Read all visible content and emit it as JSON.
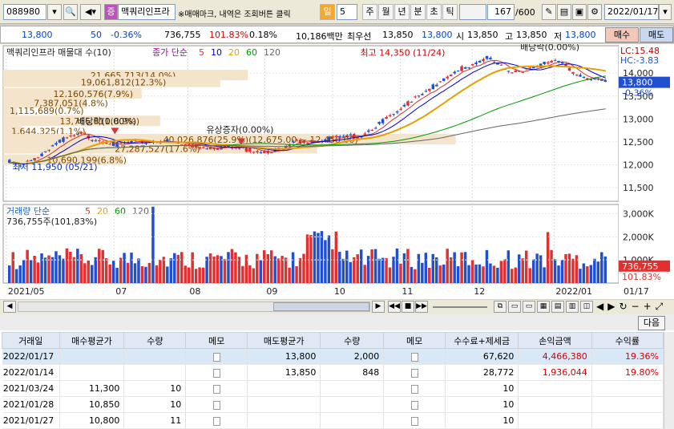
{
  "toolbar": {
    "code": "088980",
    "mark": "증",
    "stock_name": "맥쿼리인프라",
    "notice": "※매매마크, 내역은 조회버튼 클릭",
    "period_type": "일",
    "period_value": "5",
    "periods": [
      "주",
      "월",
      "년",
      "분",
      "초",
      "틱"
    ],
    "count": "167",
    "count_total": "/600",
    "date": "2022/01/17"
  },
  "quote": {
    "price": "13,800",
    "change_qty": "50",
    "change_pct": "-0.36%",
    "volume": "736,755",
    "vol_ratio": "101.83%",
    "turnover": "0.18%",
    "trade_value": "10,186백만",
    "best_ask_label": "최우선",
    "best_ask": "13,850",
    "best_bid": "13,800",
    "open_label": "시",
    "open": "13,850",
    "high_label": "고",
    "high": "13,850",
    "low_label": "저",
    "low": "13,800",
    "buy_label": "매수",
    "sell_label": "매도"
  },
  "chart": {
    "title": "맥쿼리인프라 매물대 수(10)",
    "ma_label": "종가 단순",
    "ma_periods": [
      "5",
      "10",
      "20",
      "60",
      "120"
    ],
    "ma_colors": [
      "#cc3333",
      "#0000cc",
      "#e6a000",
      "#009900",
      "#666666"
    ],
    "lc": "LC:15.48",
    "hc": "HC:-3.83",
    "current_price": "13,800",
    "current_pct": "-0.36%",
    "y_ticks": [
      "14,000",
      "13,500",
      "13,000",
      "12,500",
      "12,000",
      "11,500"
    ],
    "price_range": [
      11200,
      14600
    ],
    "annotations": {
      "high": "최고 14,350 (11/24)",
      "low": "최저 11,950 (05/21)",
      "dividend": "배당락(0.00%)",
      "dividend2": "배당락(0.00%)",
      "rights": "유상증자(0.00%)"
    },
    "volume_profile": [
      {
        "text": "21,665,713(14.0%)",
        "price": 13950,
        "frac": 0.53
      },
      {
        "text": "19,061,812(12.3%)",
        "price": 13800,
        "frac": 0.47
      },
      {
        "text": "12,160,576(7.9%)",
        "price": 13550,
        "frac": 0.3
      },
      {
        "text": "7,387,051(4.8%)",
        "price": 13350,
        "frac": 0.18
      },
      {
        "text": "1,115,689(0.7%)",
        "price": 13180,
        "frac": 0.03
      },
      {
        "text": "13,766,811(8.9%)",
        "price": 12950,
        "frac": 0.34
      },
      {
        "text": "1,644,325(1.1%)",
        "price": 12730,
        "frac": 0.04
      },
      {
        "text": "40,026,876(25.9%)(12,675.00 ~ 12,450.00)",
        "price": 12550,
        "frac": 0.98
      },
      {
        "text": "27,287,527(17.6%)",
        "price": 12350,
        "frac": 0.68
      },
      {
        "text": "10,690,199(6.8%)",
        "price": 12100,
        "frac": 0.26
      }
    ],
    "volume_label": "거래량 단순",
    "volume_ma": [
      "5",
      "20",
      "60",
      "120"
    ],
    "volume_now": "736,755주(101,83%)",
    "vol_ticks": [
      "3,000K",
      "2,000K",
      "1,000K"
    ],
    "vol_current": "736,755",
    "vol_current_pct": "101.83%",
    "x_labels": [
      "2021/05",
      "07",
      "08",
      "09",
      "10",
      "11",
      "12",
      "2022/01",
      "01/17"
    ]
  },
  "chart_data": {
    "type": "candlestick",
    "price_ylim": [
      11200,
      14600
    ],
    "volume_ylim": [
      0,
      3400000
    ],
    "price_path": [
      [
        0,
        12050
      ],
      [
        0.02,
        11950
      ],
      [
        0.05,
        12200
      ],
      [
        0.08,
        12500
      ],
      [
        0.12,
        12650
      ],
      [
        0.15,
        12550
      ],
      [
        0.18,
        12450
      ],
      [
        0.22,
        12500
      ],
      [
        0.26,
        12520
      ],
      [
        0.3,
        12400
      ],
      [
        0.34,
        12380
      ],
      [
        0.38,
        12350
      ],
      [
        0.42,
        12300
      ],
      [
        0.46,
        12320
      ],
      [
        0.48,
        12500
      ],
      [
        0.52,
        12550
      ],
      [
        0.56,
        12580
      ],
      [
        0.59,
        12650
      ],
      [
        0.62,
        12900
      ],
      [
        0.65,
        13100
      ],
      [
        0.68,
        13500
      ],
      [
        0.72,
        13750
      ],
      [
        0.76,
        14100
      ],
      [
        0.8,
        14350
      ],
      [
        0.84,
        14000
      ],
      [
        0.88,
        14150
      ],
      [
        0.92,
        14250
      ],
      [
        0.95,
        14000
      ],
      [
        1.0,
        13800
      ]
    ]
  },
  "scrollbar": {
    "left_arrow": "◀",
    "right_arrow": "▶"
  },
  "table": {
    "next_label": "다음",
    "headers": [
      "거래일",
      "매수평균가",
      "수량",
      "메모",
      "매도평균가",
      "수량",
      "메모",
      "수수료+제세금",
      "손익금액",
      "수익률"
    ],
    "rows": [
      [
        "2022/01/17",
        "",
        "",
        "",
        "13,800",
        "2,000",
        "",
        "67,620",
        "4,466,380",
        "19.36%"
      ],
      [
        "2022/01/14",
        "",
        "",
        "",
        "13,850",
        "848",
        "",
        "28,772",
        "1,936,044",
        "19.80%"
      ],
      [
        "2021/03/24",
        "11,300",
        "10",
        "",
        "",
        "",
        "",
        "10",
        "",
        ""
      ],
      [
        "2021/01/28",
        "10,850",
        "10",
        "",
        "",
        "",
        "",
        "10",
        "",
        ""
      ],
      [
        "2021/01/27",
        "10,800",
        "11",
        "",
        "",
        "",
        "",
        "10",
        "",
        ""
      ]
    ]
  }
}
